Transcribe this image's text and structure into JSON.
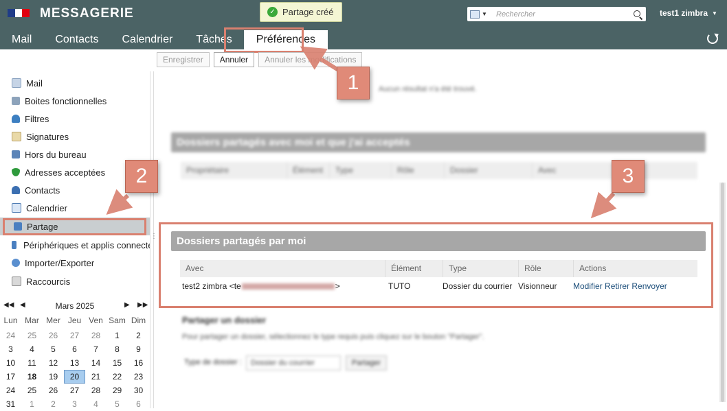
{
  "header": {
    "app_title": "MESSAGERIE",
    "toast": "Partage créé",
    "search_placeholder": "Rechercher",
    "user": "test1 zimbra",
    "colors": {
      "header_bg": "#4b6365",
      "annotation": "#d9806f"
    }
  },
  "tabs": [
    {
      "label": "Mail"
    },
    {
      "label": "Contacts"
    },
    {
      "label": "Calendrier"
    },
    {
      "label": "Tâches"
    },
    {
      "label": "Préférences",
      "active": true
    }
  ],
  "toolbar": {
    "save": "Enregistrer",
    "cancel": "Annuler",
    "revert": "Annuler les modifications"
  },
  "sidebar": {
    "items": [
      {
        "label": "Mail",
        "icon": "envelope-icon"
      },
      {
        "label": "Boites fonctionnelles",
        "icon": "mailboxes-icon"
      },
      {
        "label": "Filtres",
        "icon": "filter-icon"
      },
      {
        "label": "Signatures",
        "icon": "signature-icon"
      },
      {
        "label": "Hors du bureau",
        "icon": "out-of-office-icon"
      },
      {
        "label": "Adresses acceptées",
        "icon": "shield-icon"
      },
      {
        "label": "Contacts",
        "icon": "contact-icon"
      },
      {
        "label": "Calendrier",
        "icon": "calendar-icon"
      },
      {
        "label": "Partage",
        "icon": "share-icon",
        "selected": true
      },
      {
        "label": "Périphériques et applis connectés",
        "icon": "device-icon"
      },
      {
        "label": "Importer/Exporter",
        "icon": "import-export-icon"
      },
      {
        "label": "Raccourcis",
        "icon": "shortcut-icon"
      }
    ]
  },
  "calendar": {
    "month": "Mars 2025",
    "days": [
      "Lun",
      "Mar",
      "Mer",
      "Jeu",
      "Ven",
      "Sam",
      "Dim"
    ],
    "weeks": [
      [
        "24",
        "25",
        "26",
        "27",
        "28",
        "1",
        "2"
      ],
      [
        "3",
        "4",
        "5",
        "6",
        "7",
        "8",
        "9"
      ],
      [
        "10",
        "11",
        "12",
        "13",
        "14",
        "15",
        "16"
      ],
      [
        "17",
        "18",
        "19",
        "20",
        "21",
        "22",
        "23"
      ],
      [
        "24",
        "25",
        "26",
        "27",
        "28",
        "29",
        "30"
      ],
      [
        "31",
        "1",
        "2",
        "3",
        "4",
        "5",
        "6"
      ]
    ],
    "today": "18",
    "selected": "20"
  },
  "main": {
    "no_result": "Aucun résultat n'a été trouvé.",
    "accepted": {
      "title": "Dossiers partagés avec moi et que j'ai acceptés",
      "columns": [
        "Propriétaire",
        "Élément",
        "Type",
        "Rôle",
        "Dossier",
        "Avec"
      ]
    },
    "shared_by_me": {
      "title": "Dossiers partagés par moi",
      "columns": [
        "Avec",
        "Élément",
        "Type",
        "Rôle",
        "Actions"
      ],
      "row": {
        "with_prefix": "test2 zimbra <te",
        "with_suffix": ">",
        "element": "TUTO",
        "type": "Dossier du courrier",
        "role": "Visionneur",
        "actions": [
          "Modifier",
          "Retirer",
          "Renvoyer"
        ]
      }
    },
    "share_folder": {
      "title": "Partager un dossier",
      "help": "Pour partager un dossier, sélectionnez le type requis puis cliquez sur le bouton \"Partager\".",
      "type_label": "Type de dossier :",
      "type_value": "Dossier du courrier",
      "button": "Partager"
    }
  },
  "callouts": [
    "1",
    "2",
    "3"
  ]
}
